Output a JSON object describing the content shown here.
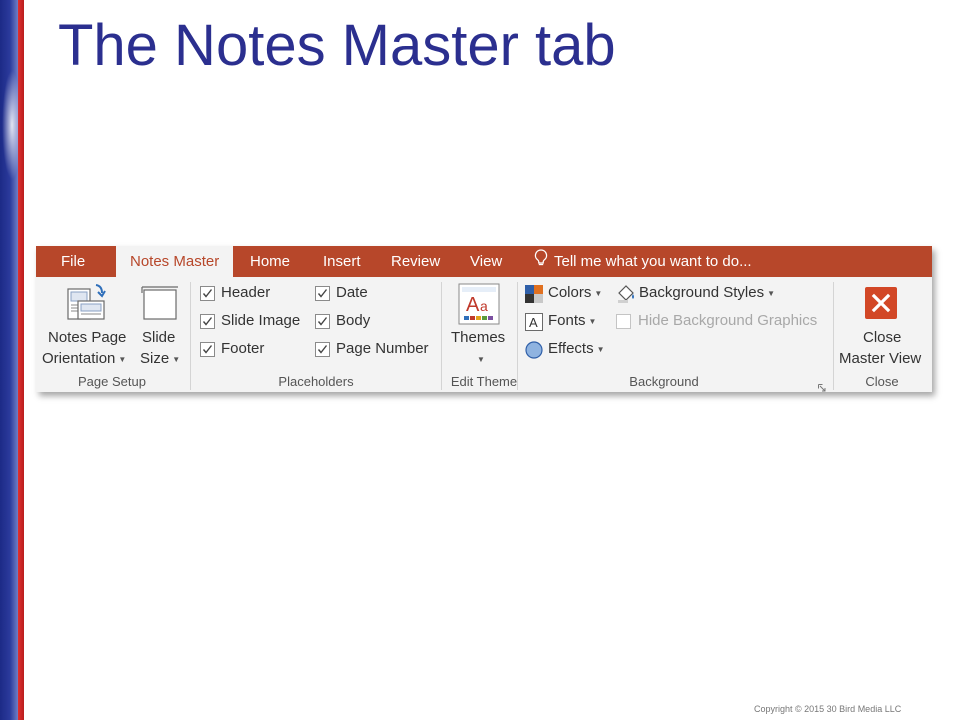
{
  "slide": {
    "title": "The Notes Master tab",
    "copyright": "Copyright © 2015 30 Bird Media LLC"
  },
  "ribbon": {
    "tabs": [
      {
        "label": "File"
      },
      {
        "label": "Notes Master"
      },
      {
        "label": "Home"
      },
      {
        "label": "Insert"
      },
      {
        "label": "Review"
      },
      {
        "label": "View"
      }
    ],
    "tell_me": "Tell me what you want to do...",
    "page_setup": {
      "notes_orientation_line1": "Notes Page",
      "notes_orientation_line2": "Orientation",
      "slide_size_line1": "Slide",
      "slide_size_line2": "Size",
      "group_label": "Page Setup"
    },
    "placeholders": {
      "items": [
        {
          "label": "Header",
          "checked": true
        },
        {
          "label": "Slide Image",
          "checked": true
        },
        {
          "label": "Footer",
          "checked": true
        },
        {
          "label": "Date",
          "checked": true
        },
        {
          "label": "Body",
          "checked": true
        },
        {
          "label": "Page Number",
          "checked": true
        }
      ],
      "group_label": "Placeholders"
    },
    "edit_theme": {
      "themes_label": "Themes",
      "group_label": "Edit Theme"
    },
    "background": {
      "colors_label": "Colors",
      "fonts_label": "Fonts",
      "effects_label": "Effects",
      "background_styles_label": "Background Styles",
      "hide_graphics_label": "Hide Background Graphics",
      "group_label": "Background"
    },
    "close": {
      "close_line1": "Close",
      "close_line2": "Master View",
      "group_label": "Close"
    },
    "colors": {
      "tab_bar": "#b7472a",
      "ribbon_body": "#f3f3f3",
      "title": "#2b2f8f"
    }
  }
}
